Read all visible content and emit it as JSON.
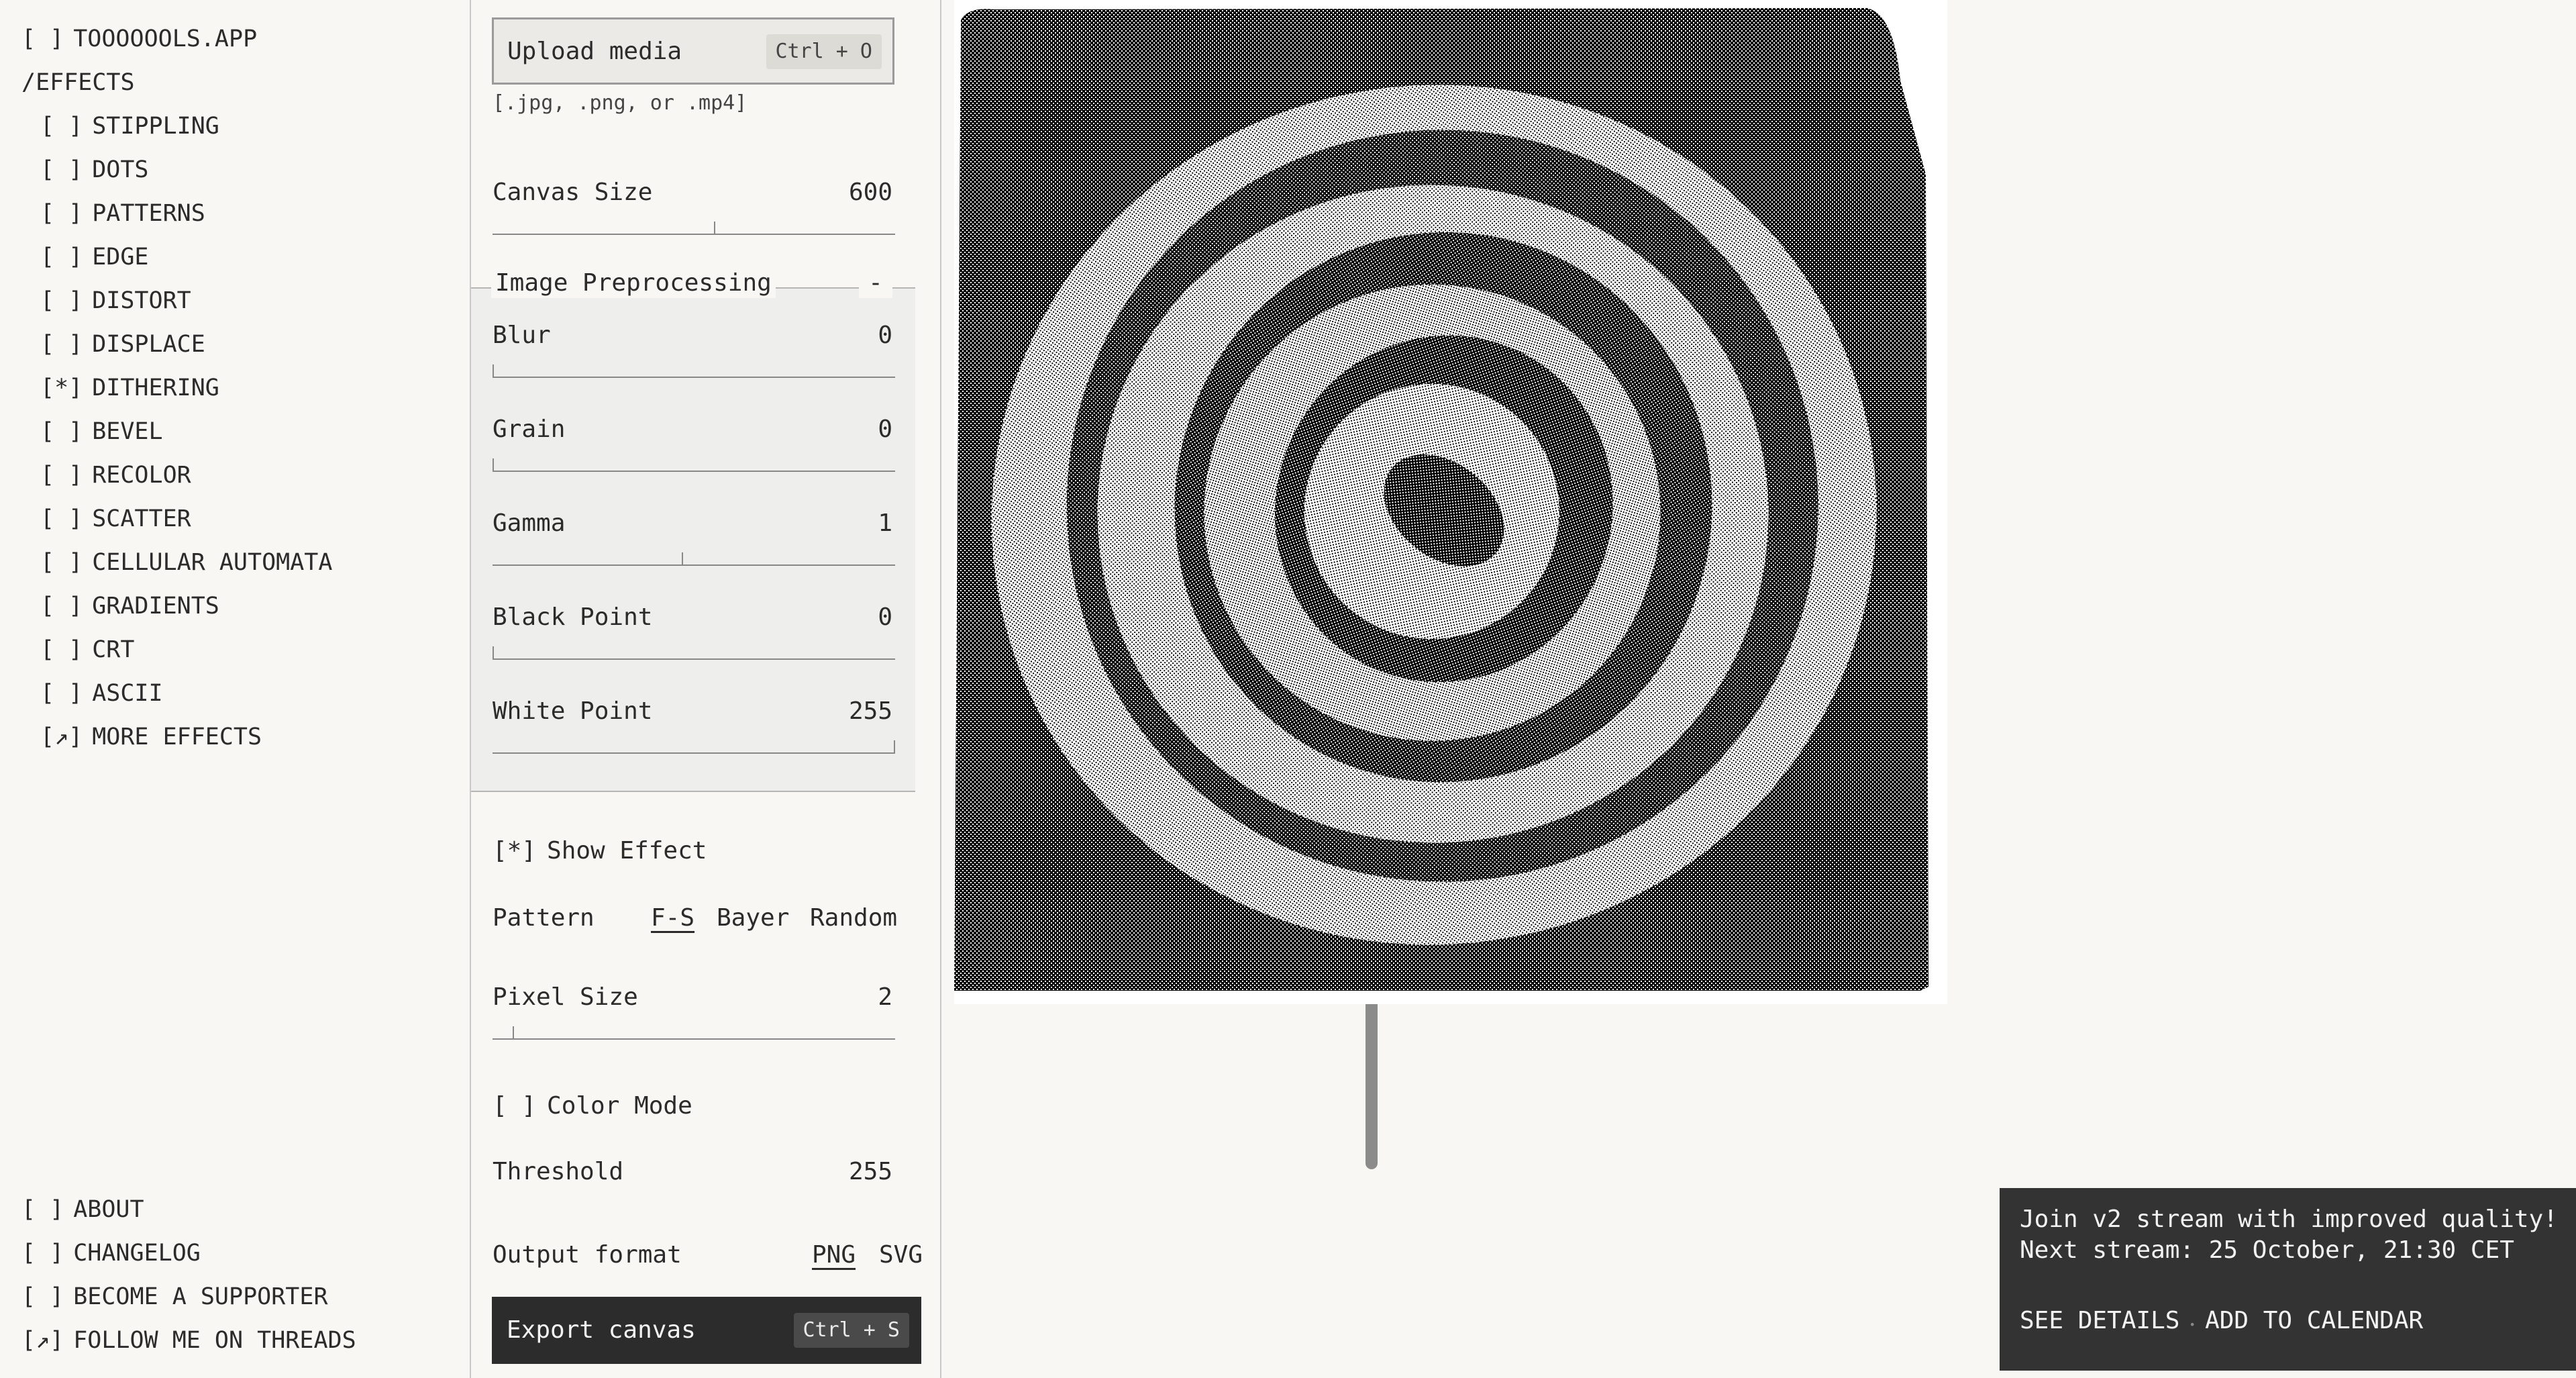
{
  "nav": {
    "site": "TOOOOOOLS.APP",
    "section": "/EFFECTS",
    "effects": [
      {
        "mark": "[ ]",
        "label": "STIPPLING"
      },
      {
        "mark": "[ ]",
        "label": "DOTS"
      },
      {
        "mark": "[ ]",
        "label": "PATTERNS"
      },
      {
        "mark": "[ ]",
        "label": "EDGE"
      },
      {
        "mark": "[ ]",
        "label": "DISTORT"
      },
      {
        "mark": "[ ]",
        "label": "DISPLACE"
      },
      {
        "mark": "[*]",
        "label": "DITHERING"
      },
      {
        "mark": "[ ]",
        "label": "BEVEL"
      },
      {
        "mark": "[ ]",
        "label": "RECOLOR"
      },
      {
        "mark": "[ ]",
        "label": "SCATTER"
      },
      {
        "mark": "[ ]",
        "label": "CELLULAR AUTOMATA"
      },
      {
        "mark": "[ ]",
        "label": "GRADIENTS"
      },
      {
        "mark": "[ ]",
        "label": "CRT"
      },
      {
        "mark": "[ ]",
        "label": "ASCII"
      },
      {
        "mark": "[↗]",
        "label": "MORE EFFECTS"
      }
    ],
    "footer": [
      {
        "mark": "[ ]",
        "label": "ABOUT"
      },
      {
        "mark": "[ ]",
        "label": "CHANGELOG"
      },
      {
        "mark": "[ ]",
        "label": "BECOME A SUPPORTER"
      },
      {
        "mark": "[↗]",
        "label": "FOLLOW ME ON THREADS"
      }
    ],
    "site_mark": "[ ]"
  },
  "panel": {
    "upload": {
      "label": "Upload media",
      "shortcut": "Ctrl + O",
      "formats": "[.jpg, .png, or .mp4]"
    },
    "canvas_size": {
      "label": "Canvas Size",
      "value": "600",
      "level": 0.55
    },
    "preprocessing": {
      "title": "Image Preprocessing",
      "collapse": "-",
      "controls": [
        {
          "label": "Blur",
          "value": "0",
          "level": 0
        },
        {
          "label": "Grain",
          "value": "0",
          "level": 0
        },
        {
          "label": "Gamma",
          "value": "1",
          "level": 0.47
        },
        {
          "label": "Black Point",
          "value": "0",
          "level": 0
        },
        {
          "label": "White Point",
          "value": "255",
          "level": 1
        }
      ]
    },
    "show_effect": {
      "mark": "[*]",
      "label": "Show Effect"
    },
    "pattern": {
      "label": "Pattern",
      "options": [
        "F-S",
        "Bayer",
        "Random"
      ],
      "selected": "F-S"
    },
    "pixel_size": {
      "label": "Pixel Size",
      "value": "2",
      "level": 0.05
    },
    "color_mode": {
      "mark": "[ ]",
      "label": "Color Mode"
    },
    "threshold": {
      "label": "Threshold",
      "value": "255"
    },
    "output_format": {
      "label": "Output format",
      "options": [
        "PNG",
        "SVG"
      ],
      "selected": "PNG"
    },
    "export": {
      "label": "Export canvas",
      "shortcut": "Ctrl + S"
    }
  },
  "toast": {
    "line1": "Join v2 stream with improved quality!",
    "line2": "Next stream: 25 October, 21:30 CET",
    "see_details": "SEE DETAILS",
    "separator": "•",
    "add_calendar": "ADD TO CALENDAR"
  },
  "colors": {
    "background": "#f8f7f3",
    "ink": "#2b2b2b",
    "toast": "#333333",
    "export_button": "#2c2c2c"
  }
}
